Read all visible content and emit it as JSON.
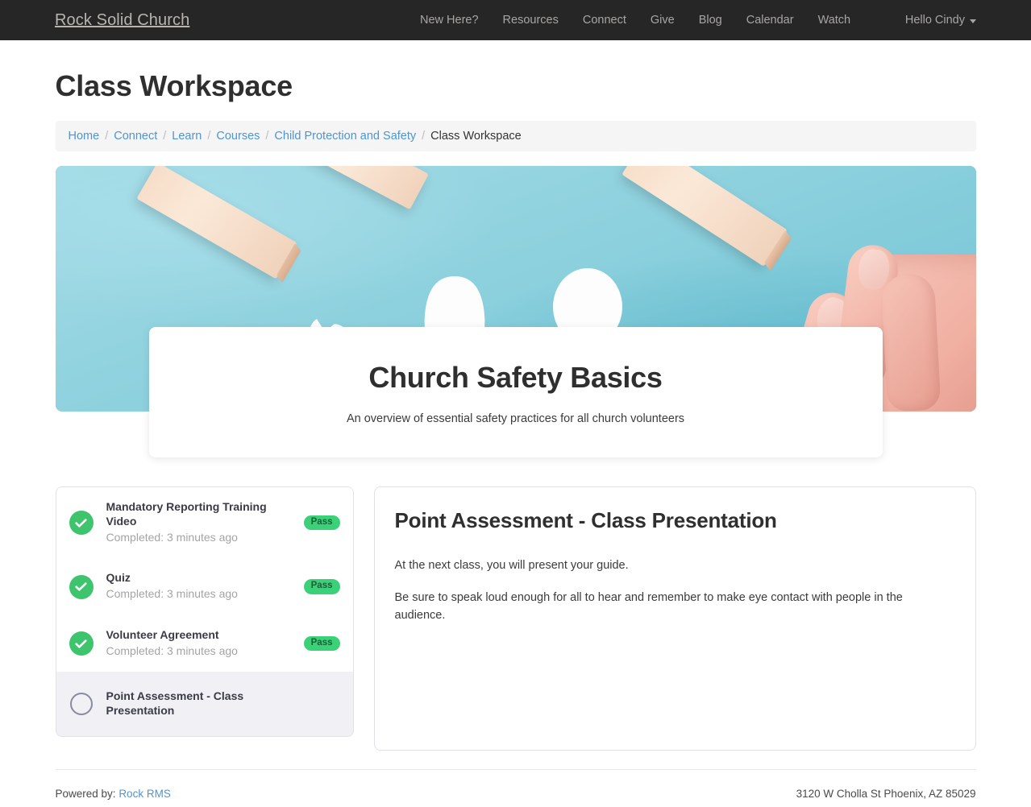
{
  "navbar": {
    "brand": "Rock Solid Church",
    "links": [
      {
        "label": "New Here?"
      },
      {
        "label": "Resources"
      },
      {
        "label": "Connect"
      },
      {
        "label": "Give"
      },
      {
        "label": "Blog"
      },
      {
        "label": "Calendar"
      },
      {
        "label": "Watch"
      }
    ],
    "user_menu": "Hello Cindy",
    "caret_icon": "chevron-down-icon",
    "background_color": "#262626",
    "link_color": "#a8a6a3"
  },
  "page": {
    "title": "Class Workspace"
  },
  "breadcrumb": {
    "separator": "/",
    "items": [
      {
        "label": "Home",
        "current": false
      },
      {
        "label": "Connect",
        "current": false
      },
      {
        "label": "Learn",
        "current": false
      },
      {
        "label": "Courses",
        "current": false
      },
      {
        "label": "Child Protection and Safety",
        "current": false
      },
      {
        "label": "Class Workspace",
        "current": true
      }
    ],
    "link_color": "#4f95d1",
    "background_color": "#f5f5f5"
  },
  "hero": {
    "image_alt": "paper cut-out family figures with wooden blocks and a hand on light blue background",
    "title": "Church Safety Basics",
    "subtitle": "An overview of essential safety practices for all church volunteers"
  },
  "activities": {
    "items": [
      {
        "title": "Mandatory Reporting Training Video",
        "status_text": "Completed: 3 minutes ago",
        "badge": "Pass",
        "icon": "check-circle-icon",
        "completed": true,
        "active": false
      },
      {
        "title": "Quiz",
        "status_text": "Completed: 3 minutes ago",
        "badge": "Pass",
        "icon": "check-circle-icon",
        "completed": true,
        "active": false
      },
      {
        "title": "Volunteer Agreement",
        "status_text": "Completed: 3 minutes ago",
        "badge": "Pass",
        "icon": "check-circle-icon",
        "completed": true,
        "active": false
      },
      {
        "title": "Point Assessment - Class Presentation",
        "status_text": "",
        "badge": "",
        "icon": "empty-circle-icon",
        "completed": false,
        "active": true
      }
    ],
    "badge_background": "#3bd179",
    "badge_text_color": "#1f5d38",
    "check_color": "#3ec46d",
    "active_row_background": "#f0f0f5"
  },
  "detail": {
    "title": "Point Assessment - Class Presentation",
    "paragraphs": [
      "At the next class, you will present your guide.",
      "Be sure to speak loud enough for all to hear and remember to make eye contact with people in the audience."
    ]
  },
  "footer": {
    "powered_by_label": "Powered by:",
    "powered_by_link": "Rock RMS",
    "address": "3120 W Cholla St Phoenix, AZ 85029"
  }
}
